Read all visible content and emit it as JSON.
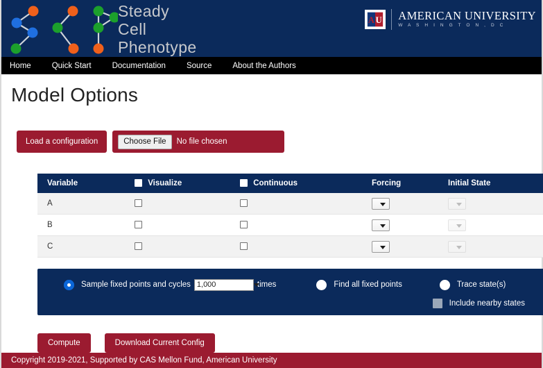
{
  "header": {
    "brand_title": "Steady\nCell\nPhenotype",
    "university": {
      "name": "AMERICAN UNIVERSITY",
      "subtitle": "W A S H I N G T O N ,  D C",
      "monogram": "AU"
    }
  },
  "nav": {
    "items": [
      {
        "label": "Home"
      },
      {
        "label": "Quick Start"
      },
      {
        "label": "Documentation"
      },
      {
        "label": "Source"
      },
      {
        "label": "About the Authors"
      }
    ]
  },
  "main": {
    "page_title": "Model Options",
    "load_config_button": "Load a configuration",
    "file_input": {
      "button_label": "Choose File",
      "status": "No file chosen"
    }
  },
  "table": {
    "headers": {
      "variable": "Variable",
      "visualize": "Visualize",
      "continuous": "Continuous",
      "forcing": "Forcing",
      "initial_state": "Initial State"
    },
    "rows": [
      {
        "variable": "A",
        "visualize": false,
        "continuous": false,
        "forcing": "",
        "initial_state": ""
      },
      {
        "variable": "B",
        "visualize": false,
        "continuous": false,
        "forcing": "",
        "initial_state": ""
      },
      {
        "variable": "C",
        "visualize": false,
        "continuous": false,
        "forcing": "",
        "initial_state": ""
      }
    ]
  },
  "options": {
    "sample": {
      "label_before": "Sample fixed points and cycles",
      "times_value": "1,000",
      "label_after": "times",
      "selected": true
    },
    "find_all": {
      "label": "Find all fixed points",
      "selected": false
    },
    "trace": {
      "label": "Trace state(s)",
      "selected": false
    },
    "include_nearby": {
      "label": "Include nearby states",
      "checked": false,
      "disabled": true
    }
  },
  "actions": {
    "compute": "Compute",
    "download": "Download Current Config"
  },
  "footer": {
    "copyright": "Copyright 2019-2021, Supported by CAS Mellon Fund, American University"
  },
  "colors": {
    "navy": "#0b2a5b",
    "maroon": "#9b1b30",
    "nav_black": "#000000",
    "accent_blue": "#0b66d8",
    "node_orange": "#f0601b",
    "node_green": "#1ca02c",
    "node_blue": "#1f6fe0"
  }
}
